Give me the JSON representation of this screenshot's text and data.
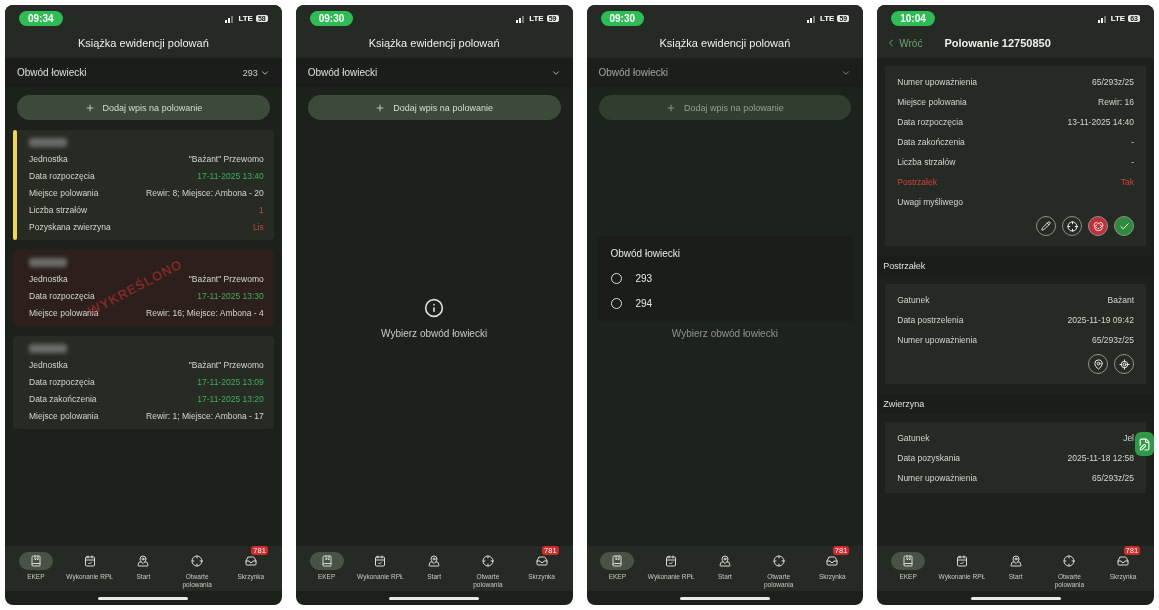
{
  "phones": [
    {
      "kind": "list",
      "status": {
        "time": "09:34",
        "network": "LTE",
        "battery": "58"
      },
      "title": "Książka ewidencji polowań",
      "selector": {
        "label": "Obwód łowiecki",
        "value": "293"
      },
      "add_button": "Dodaj wpis na polowanie",
      "entries": [
        {
          "flagged": true,
          "rows": [
            {
              "label": "Jednostka",
              "value": "\"Bażant\" Przewomo",
              "kind": "plain"
            },
            {
              "label": "Data rozpoczęcia",
              "value": "17-11-2025 13:40",
              "kind": "date"
            },
            {
              "label": "Miejsce polowania",
              "value": "Rewir: 8; Miejsce: Ambona - 20",
              "kind": "plain"
            },
            {
              "label": "Liczba strzałów",
              "value": "1",
              "kind": "warning"
            },
            {
              "label": "Pozyskana zwierzyna",
              "value": "Lis",
              "kind": "warning"
            }
          ]
        },
        {
          "flagged": false,
          "stamp": "WYKREŚLONO",
          "rows": [
            {
              "label": "Jednostka",
              "value": "\"Bażant\" Przewomo",
              "kind": "plain"
            },
            {
              "label": "Data rozpoczęcia",
              "value": "17-11-2025 13:30",
              "kind": "date"
            },
            {
              "label": "Miejsce polowania",
              "value": "Rewir: 16; Miejsce: Ambona - 4",
              "kind": "plain"
            }
          ]
        },
        {
          "flagged": false,
          "rows": [
            {
              "label": "Jednostka",
              "value": "\"Bażant\" Przewomo",
              "kind": "plain"
            },
            {
              "label": "Data rozpoczęcia",
              "value": "17-11-2025 13:09",
              "kind": "date"
            },
            {
              "label": "Data zakończenia",
              "value": "17-11-2025 13:20",
              "kind": "date"
            },
            {
              "label": "Miejsce polowania",
              "value": "Rewir: 1; Miejsce: Ambona - 17",
              "kind": "plain"
            }
          ]
        }
      ],
      "nav": [
        {
          "label": "EKEP",
          "selected": true
        },
        {
          "label": "Wykonanie RPŁ",
          "selected": false
        },
        {
          "label": "Start",
          "selected": false
        },
        {
          "label": "Otwarte polowania",
          "selected": false
        },
        {
          "label": "Skrzynka",
          "selected": false,
          "badge": "781"
        }
      ]
    },
    {
      "kind": "empty",
      "status": {
        "time": "09:30",
        "network": "LTE",
        "battery": "59"
      },
      "title": "Książka ewidencji polowań",
      "selector": {
        "label": "Obwód łowiecki"
      },
      "add_button": "Dodaj wpis na polowanie",
      "message": "Wybierz obwód łowiecki",
      "nav": [
        {
          "label": "EKEP",
          "selected": true
        },
        {
          "label": "Wykonanie RPŁ",
          "selected": false
        },
        {
          "label": "Start",
          "selected": false
        },
        {
          "label": "Otwarte polowania",
          "selected": false
        },
        {
          "label": "Skrzynka",
          "selected": false,
          "badge": "781"
        }
      ]
    },
    {
      "kind": "picker",
      "status": {
        "time": "09:30",
        "network": "LTE",
        "battery": "59"
      },
      "title": "Książka ewidencji polowań",
      "selector": {
        "label": "Obwód łowiecki"
      },
      "add_button": "Dodaj wpis na polowanie",
      "message": "Wybierz obwód łowiecki",
      "dialog": {
        "title": "Obwód łowiecki",
        "options": [
          {
            "label": "293",
            "selected": false
          },
          {
            "label": "294",
            "selected": false
          }
        ]
      },
      "nav": [
        {
          "label": "EKEP",
          "selected": true
        },
        {
          "label": "Wykonanie RPŁ",
          "selected": false
        },
        {
          "label": "Start",
          "selected": false
        },
        {
          "label": "Otwarte polowania",
          "selected": false
        },
        {
          "label": "Skrzynka",
          "selected": false,
          "badge": "781"
        }
      ]
    },
    {
      "kind": "detail",
      "status": {
        "time": "10:04",
        "network": "LTE",
        "battery": "63"
      },
      "back": "Wróć",
      "title": "Polowanie 12750850",
      "rows": [
        {
          "label": "Numer upoważnienia",
          "value": "65/293z/25",
          "kind": "plain"
        },
        {
          "label": "Miejsce polowania",
          "value": "Rewir: 16",
          "kind": "plain"
        },
        {
          "label": "Data rozpoczęcia",
          "value": "13-11-2025 14:40",
          "kind": "plain"
        },
        {
          "label": "Data zakończenia",
          "value": "-",
          "kind": "plain"
        },
        {
          "label": "Liczba strzałów",
          "value": "-",
          "kind": "plain"
        },
        {
          "label": "Postrzałek",
          "value": "Tak",
          "kind": "warning-row"
        },
        {
          "label": "Uwagi myśliwego",
          "value": "",
          "kind": "plain"
        }
      ],
      "sections": [
        {
          "title": "Postrzałek",
          "rows": [
            {
              "label": "Gatunek",
              "value": "Bażant",
              "kind": "plain"
            },
            {
              "label": "Data postrzelenia",
              "value": "2025-11-19 09:42",
              "kind": "plain"
            },
            {
              "label": "Numer upoważnienia",
              "value": "65/293z/25",
              "kind": "plain"
            }
          ]
        },
        {
          "title": "Zwierzyna",
          "rows": [
            {
              "label": "Gatunek",
              "value": "Jel",
              "kind": "plain"
            },
            {
              "label": "Data pozyskania",
              "value": "2025-11-18 12:58",
              "kind": "plain"
            },
            {
              "label": "Numer upoważnienia",
              "value": "65/293z/25",
              "kind": "plain"
            }
          ]
        }
      ],
      "nav": [
        {
          "label": "EKEP",
          "selected": true
        },
        {
          "label": "Wykonanie RPŁ",
          "selected": false
        },
        {
          "label": "Start",
          "selected": false
        },
        {
          "label": "Otwarte polowania",
          "selected": false
        },
        {
          "label": "Skrzynka",
          "selected": false,
          "badge": "781"
        }
      ]
    }
  ]
}
